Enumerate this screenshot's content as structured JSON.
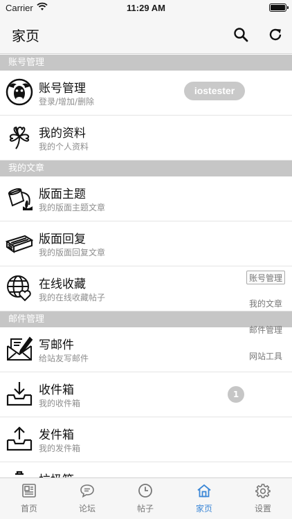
{
  "status_bar": {
    "carrier": "Carrier",
    "time": "11:29 AM"
  },
  "nav": {
    "title": "家页",
    "search_icon": "search-icon",
    "refresh_icon": "refresh-icon"
  },
  "sections": [
    {
      "header": "账号管理",
      "rows": [
        {
          "title": "账号管理",
          "subtitle": "登录/增加/删除",
          "icon": "gnu-avatar-icon",
          "pill": "iostester"
        },
        {
          "title": "我的资料",
          "subtitle": "我的个人资料",
          "icon": "clover-icon"
        }
      ]
    },
    {
      "header": "我的文章",
      "rows": [
        {
          "title": "版面主题",
          "subtitle": "我的版面主题文章",
          "icon": "paint-bucket-icon"
        },
        {
          "title": "版面回复",
          "subtitle": "我的版面回复文章",
          "icon": "board-reply-icon"
        },
        {
          "title": "在线收藏",
          "subtitle": "我的在线收藏帖子",
          "icon": "globe-heart-icon"
        }
      ]
    },
    {
      "header": "邮件管理",
      "rows": [
        {
          "title": "写邮件",
          "subtitle": "给站友写邮件",
          "icon": "write-mail-icon"
        },
        {
          "title": "收件箱",
          "subtitle": "我的收件箱",
          "icon": "inbox-icon",
          "badge": "1"
        },
        {
          "title": "发件箱",
          "subtitle": "我的发件箱",
          "icon": "outbox-icon"
        },
        {
          "title": "垃圾箱",
          "subtitle": "",
          "icon": "trash-box-icon"
        }
      ]
    }
  ],
  "section_index": [
    "账号管理",
    "我的文章",
    "邮件管理",
    "网站工具"
  ],
  "tabs": [
    {
      "label": "首页",
      "icon": "newspaper-icon",
      "active": false
    },
    {
      "label": "论坛",
      "icon": "chat-bubble-icon",
      "active": false
    },
    {
      "label": "帖子",
      "icon": "clock-icon",
      "active": false
    },
    {
      "label": "家页",
      "icon": "home-icon",
      "active": true
    },
    {
      "label": "设置",
      "icon": "gear-icon",
      "active": false
    }
  ],
  "colors": {
    "accent": "#3a86d6",
    "section_header_bg": "#c6c6c6",
    "bar_bg": "#f6f6f6"
  }
}
